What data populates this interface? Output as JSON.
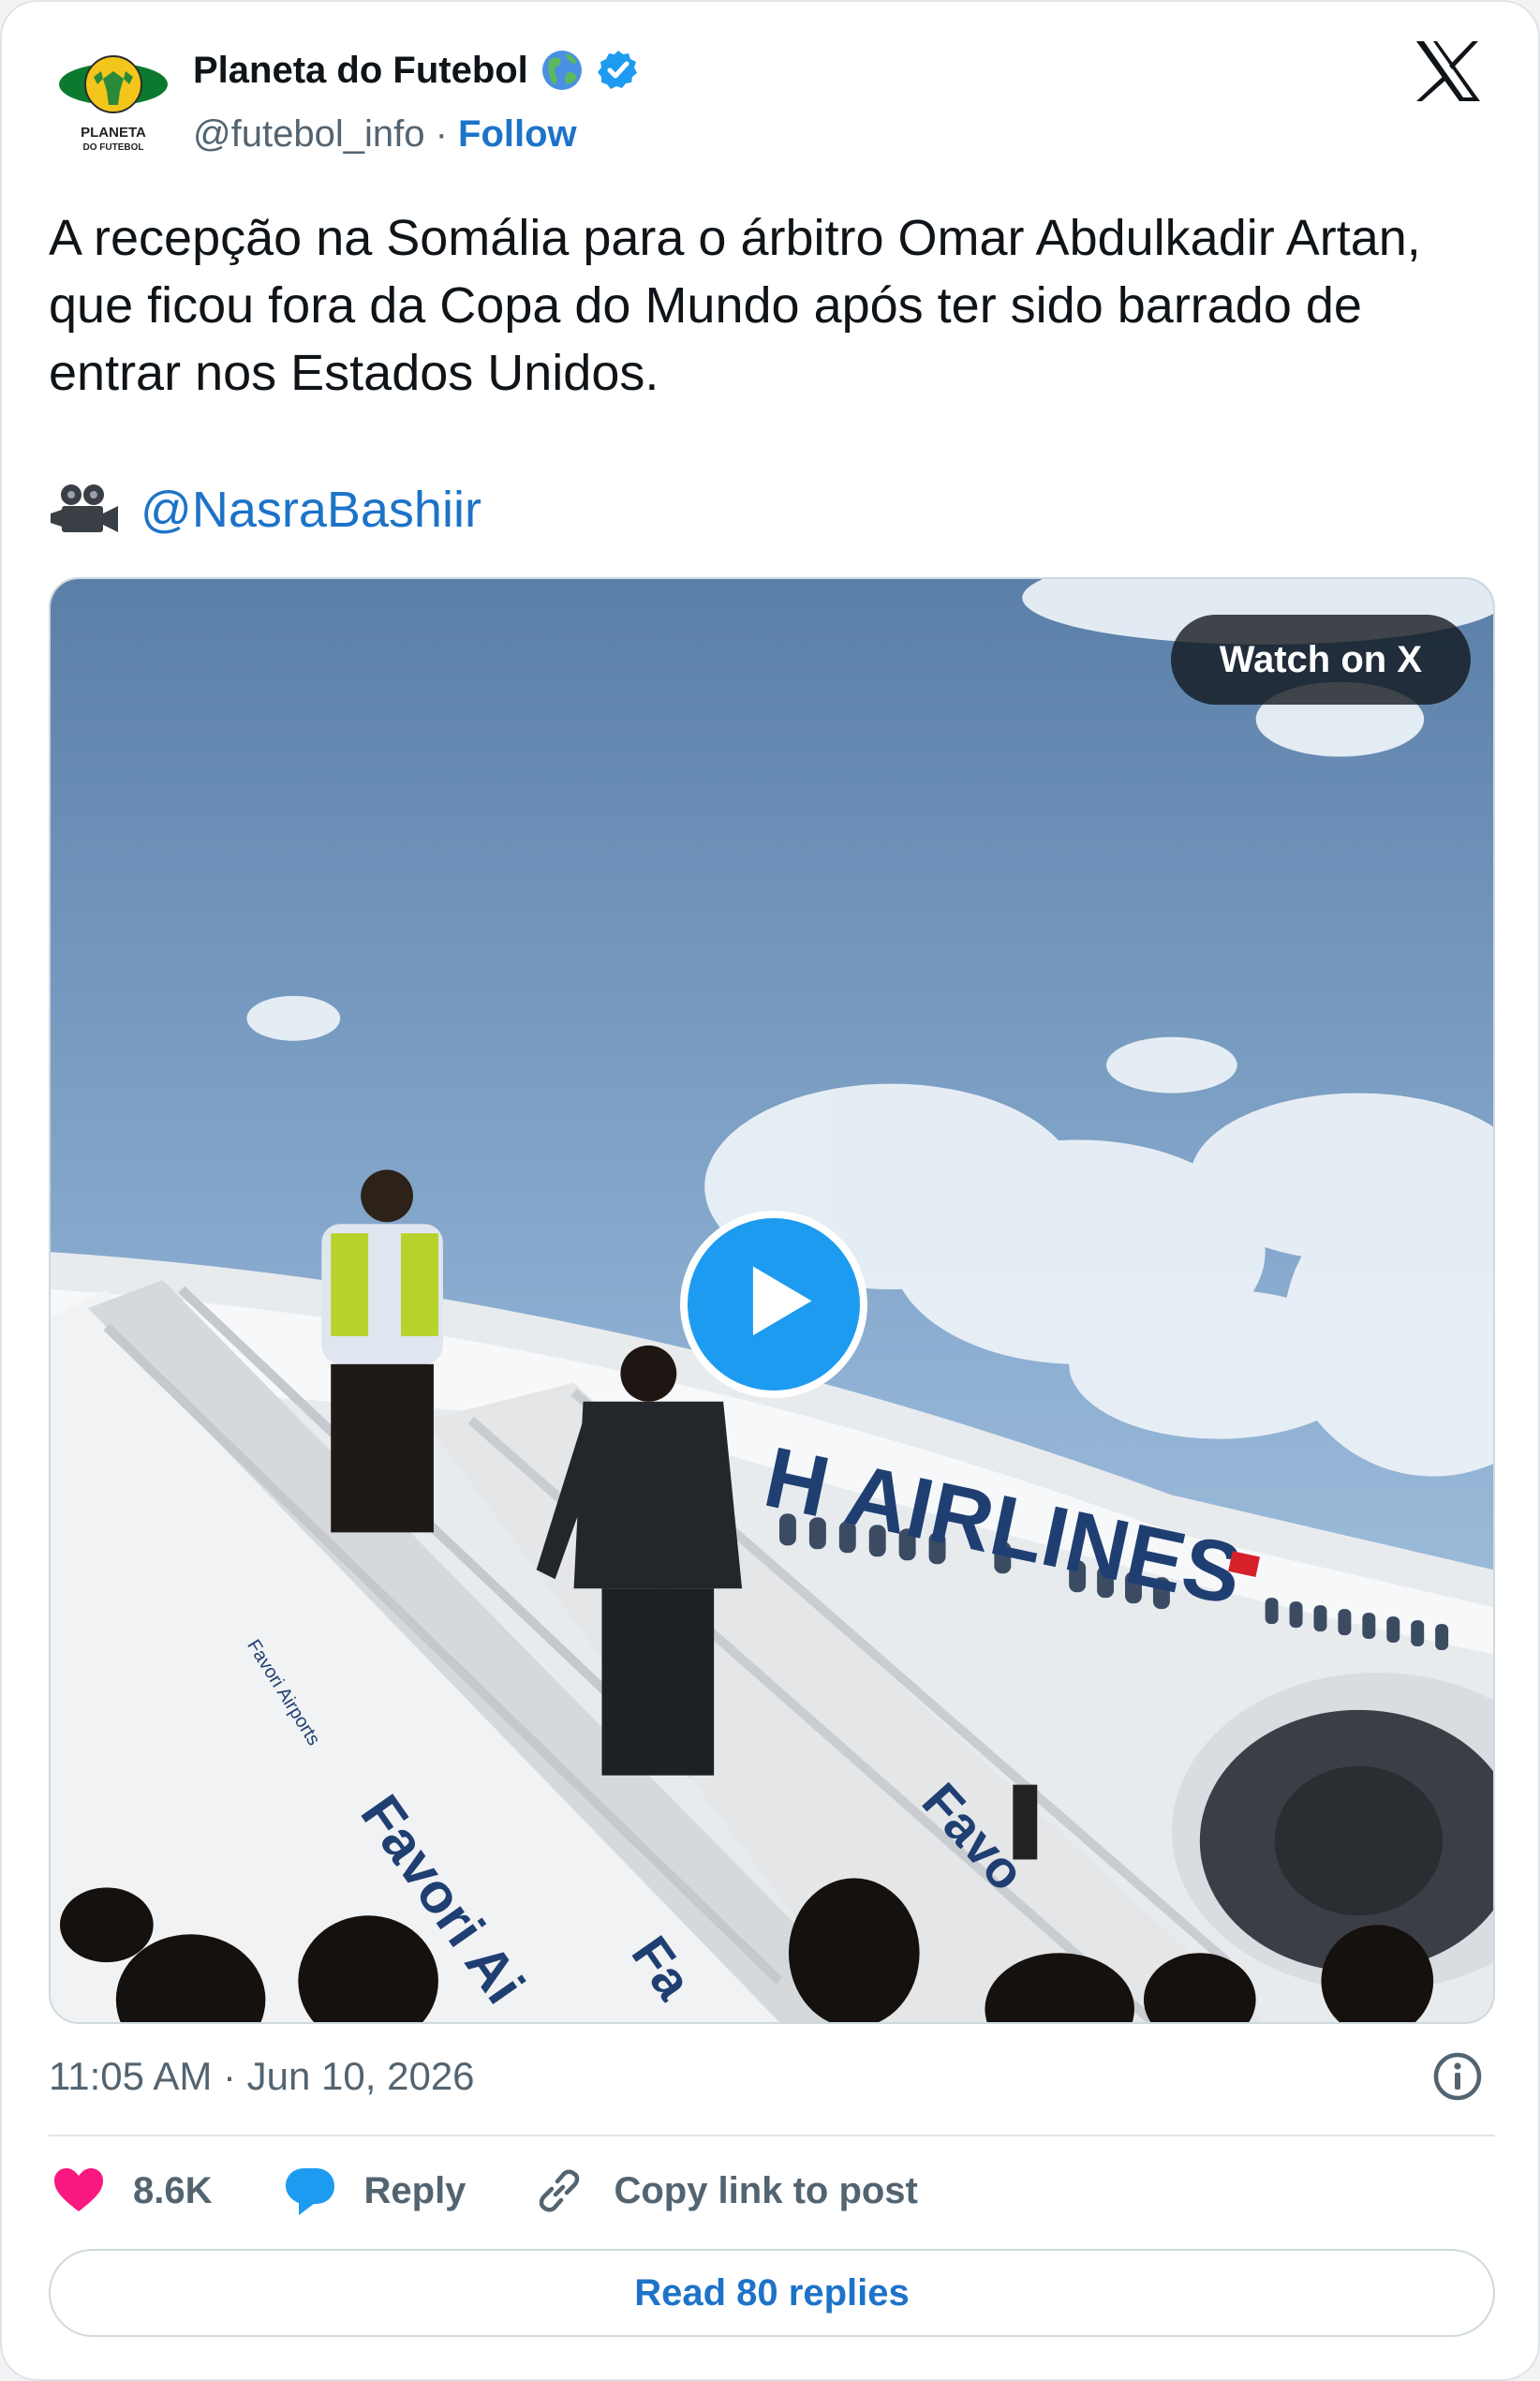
{
  "author": {
    "display_name": "Planeta do Futebol",
    "handle": "@futebol_info",
    "separator": "·",
    "follow_label": "Follow",
    "logo_text_line1": "PLANETA",
    "logo_text_line2": "DO FUTEBOL",
    "name_emoji_icon": "globe-americas-icon",
    "verified_icon": "verified-badge-icon"
  },
  "post": {
    "text": "A recepção na Somália para o árbitro Omar Abdulkadir Artan, que ficou fora da Copa do Mundo após ter sido barrado de entrar nos Estados Unidos.",
    "credit_icon": "movie-camera-icon",
    "credit_mention": "@NasraBashiir"
  },
  "media": {
    "watch_label": "Watch on X",
    "play_icon": "play-icon",
    "scene_text_plane": "H AIRLINES",
    "scene_text_stairs_1": "Favori Ai",
    "scene_text_stairs_2": "Fa",
    "scene_text_stairs_3": "Favo",
    "scene_text_stairs_small": "Favori Airports"
  },
  "meta": {
    "timestamp": "11:05 AM · Jun 10, 2026",
    "info_icon": "info-icon"
  },
  "actions": {
    "likes_count": "8.6K",
    "reply_label": "Reply",
    "copy_link_label": "Copy link to post"
  },
  "read_replies_label": "Read 80 replies",
  "colors": {
    "link_blue": "#1d73c8",
    "verified_blue": "#1d9bf0",
    "heart_pink": "#f91880",
    "muted_text": "#536471",
    "sky": "#7fa3c9"
  }
}
